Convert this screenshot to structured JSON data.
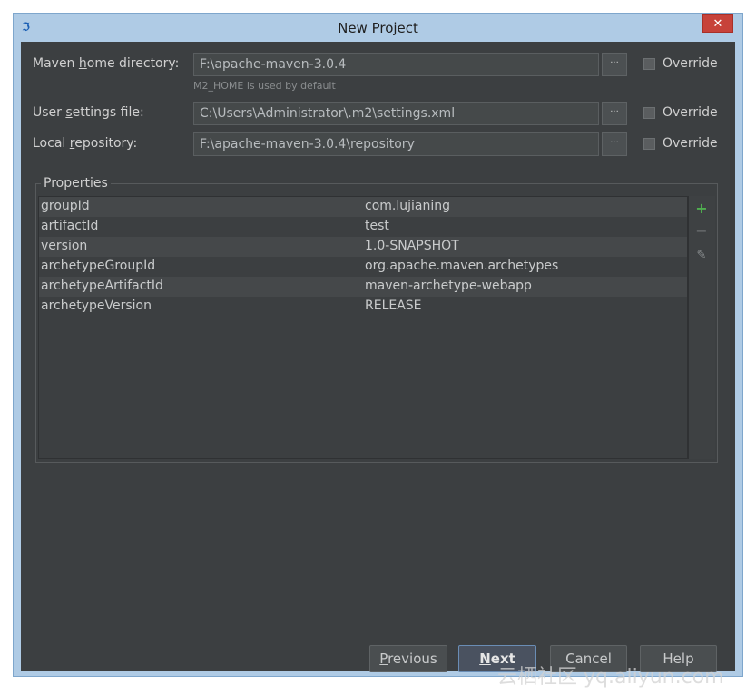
{
  "window": {
    "title": "New Project",
    "close_label": "✕",
    "app_icon": "intellij-icon"
  },
  "maven_home": {
    "label_pre": "Maven ",
    "label_u": "h",
    "label_post": "ome directory:",
    "value": "F:\\apache-maven-3.0.4",
    "hint": "M2_HOME is used by default",
    "browse": "···",
    "override_label": "Override"
  },
  "user_settings": {
    "label_pre": "User ",
    "label_u": "s",
    "label_post": "ettings file:",
    "value": "C:\\Users\\Administrator\\.m2\\settings.xml",
    "browse": "···",
    "override_label": "Override"
  },
  "local_repo": {
    "label_pre": "Local ",
    "label_u": "r",
    "label_post": "epository:",
    "value": "F:\\apache-maven-3.0.4\\repository",
    "browse": "···",
    "override_label": "Override"
  },
  "properties": {
    "title": "Properties",
    "rows": [
      {
        "key": "groupId",
        "value": "com.lujianing"
      },
      {
        "key": "artifactId",
        "value": "test"
      },
      {
        "key": "version",
        "value": "1.0-SNAPSHOT"
      },
      {
        "key": "archetypeGroupId",
        "value": "org.apache.maven.archetypes"
      },
      {
        "key": "archetypeArtifactId",
        "value": "maven-archetype-webapp"
      },
      {
        "key": "archetypeVersion",
        "value": "RELEASE"
      }
    ],
    "tools": {
      "add": "+",
      "remove": "−",
      "edit": "✎"
    }
  },
  "buttons": {
    "previous_u": "P",
    "previous_rest": "revious",
    "next_u": "N",
    "next_rest": "ext",
    "cancel": "Cancel",
    "help": "Help"
  },
  "watermark": "云栖社区 yq.aliyun.com",
  "colors": {
    "accent_green": "#4fae4f",
    "close_red": "#c7423a",
    "panel_bg": "#3c3f41"
  }
}
